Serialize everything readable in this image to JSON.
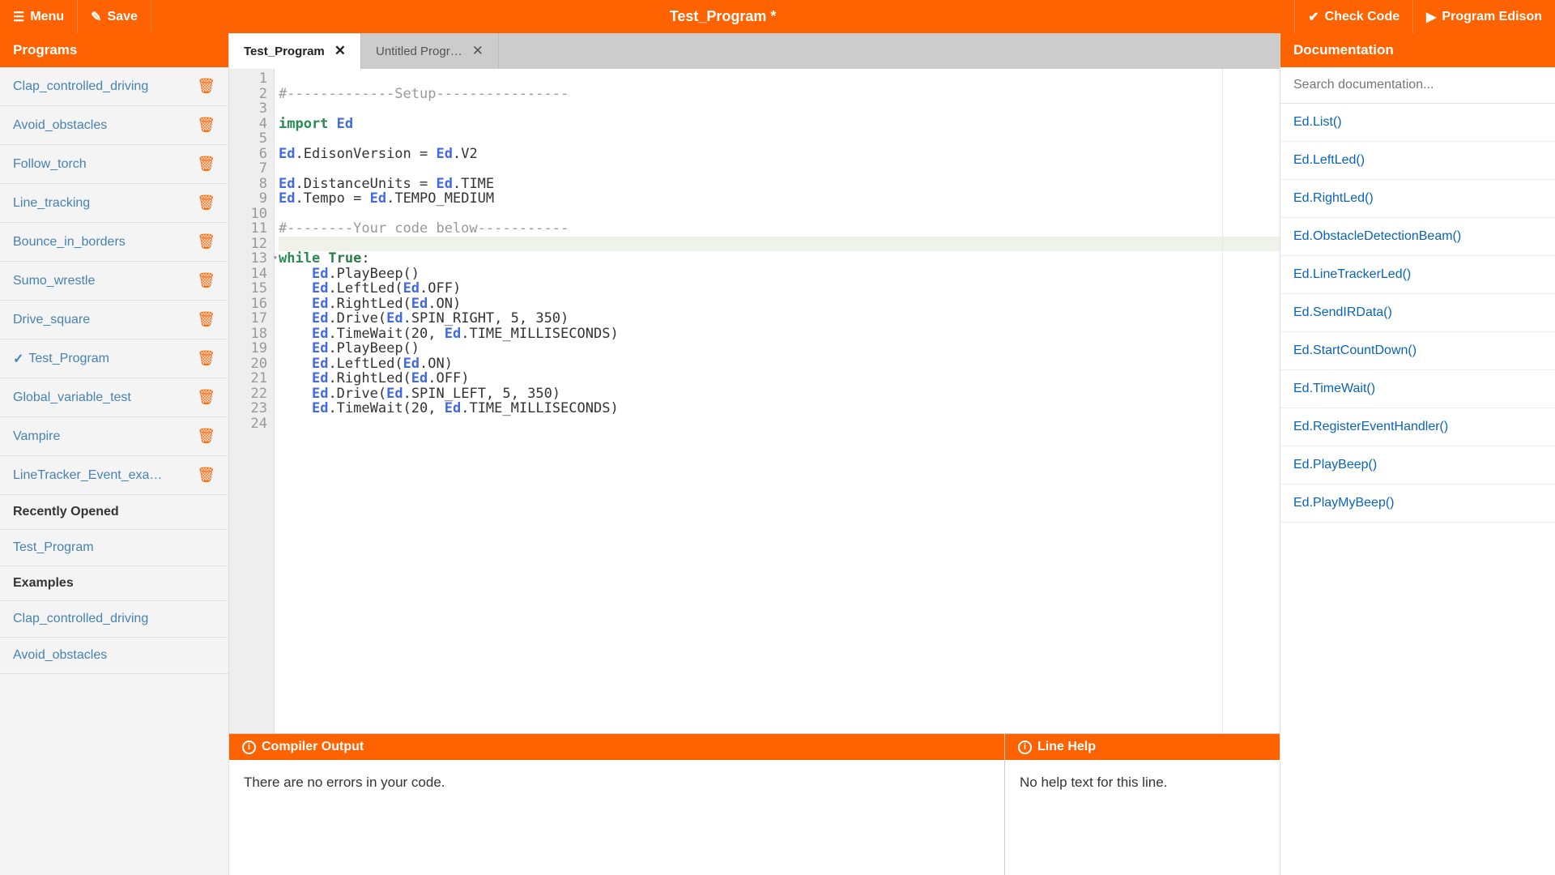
{
  "header": {
    "menu": "Menu",
    "save": "Save",
    "title": "Test_Program *",
    "check": "Check Code",
    "program": "Program Edison"
  },
  "sidebar": {
    "programs_header": "Programs",
    "recent_header": "Recently Opened",
    "examples_header": "Examples",
    "programs": [
      {
        "name": "Clap_controlled_driving",
        "selected": false
      },
      {
        "name": "Avoid_obstacles",
        "selected": false
      },
      {
        "name": "Follow_torch",
        "selected": false
      },
      {
        "name": "Line_tracking",
        "selected": false
      },
      {
        "name": "Bounce_in_borders",
        "selected": false
      },
      {
        "name": "Sumo_wrestle",
        "selected": false
      },
      {
        "name": "Drive_square",
        "selected": false
      },
      {
        "name": "Test_Program",
        "selected": true
      },
      {
        "name": "Global_variable_test",
        "selected": false
      },
      {
        "name": "Vampire",
        "selected": false
      },
      {
        "name": "LineTracker_Event_exa…",
        "selected": false
      }
    ],
    "recent": [
      {
        "name": "Test_Program"
      }
    ],
    "examples": [
      {
        "name": "Clap_controlled_driving"
      },
      {
        "name": "Avoid_obstacles"
      }
    ]
  },
  "tabs": [
    {
      "label": "Test_Program",
      "active": true
    },
    {
      "label": "Untitled Progr…",
      "active": false
    }
  ],
  "code": {
    "active_line": 12,
    "fold_lines": [
      13
    ],
    "lines": [
      {
        "n": 1,
        "t": [
          [
            "",
            ""
          ]
        ]
      },
      {
        "n": 2,
        "t": [
          [
            "cm",
            "#-------------Setup----------------"
          ]
        ]
      },
      {
        "n": 3,
        "t": [
          [
            "",
            ""
          ]
        ]
      },
      {
        "n": 4,
        "t": [
          [
            "kw",
            "import "
          ],
          [
            "mod",
            "Ed"
          ]
        ]
      },
      {
        "n": 5,
        "t": [
          [
            "",
            ""
          ]
        ]
      },
      {
        "n": 6,
        "t": [
          [
            "mod",
            "Ed"
          ],
          [
            "",
            ".EdisonVersion = "
          ],
          [
            "mod",
            "Ed"
          ],
          [
            "",
            ".V2"
          ]
        ]
      },
      {
        "n": 7,
        "t": [
          [
            "",
            ""
          ]
        ]
      },
      {
        "n": 8,
        "t": [
          [
            "mod",
            "Ed"
          ],
          [
            "",
            ".DistanceUnits = "
          ],
          [
            "mod",
            "Ed"
          ],
          [
            "",
            ".TIME"
          ]
        ]
      },
      {
        "n": 9,
        "t": [
          [
            "mod",
            "Ed"
          ],
          [
            "",
            ".Tempo = "
          ],
          [
            "mod",
            "Ed"
          ],
          [
            "",
            ".TEMPO_MEDIUM"
          ]
        ]
      },
      {
        "n": 10,
        "t": [
          [
            "",
            ""
          ]
        ]
      },
      {
        "n": 11,
        "t": [
          [
            "cm",
            "#--------Your code below-----------"
          ]
        ]
      },
      {
        "n": 12,
        "t": [
          [
            "",
            ""
          ]
        ]
      },
      {
        "n": 13,
        "t": [
          [
            "kw",
            "while "
          ],
          [
            "bool",
            "True"
          ],
          [
            "",
            ":"
          ]
        ]
      },
      {
        "n": 14,
        "t": [
          [
            "",
            "    "
          ],
          [
            "mod",
            "Ed"
          ],
          [
            "",
            ".PlayBeep()"
          ]
        ]
      },
      {
        "n": 15,
        "t": [
          [
            "",
            "    "
          ],
          [
            "mod",
            "Ed"
          ],
          [
            "",
            ".LeftLed("
          ],
          [
            "mod",
            "Ed"
          ],
          [
            "",
            ".OFF)"
          ]
        ]
      },
      {
        "n": 16,
        "t": [
          [
            "",
            "    "
          ],
          [
            "mod",
            "Ed"
          ],
          [
            "",
            ".RightLed("
          ],
          [
            "mod",
            "Ed"
          ],
          [
            "",
            ".ON)"
          ]
        ]
      },
      {
        "n": 17,
        "t": [
          [
            "",
            "    "
          ],
          [
            "mod",
            "Ed"
          ],
          [
            "",
            ".Drive("
          ],
          [
            "mod",
            "Ed"
          ],
          [
            "",
            ".SPIN_RIGHT, 5, 350)"
          ]
        ]
      },
      {
        "n": 18,
        "t": [
          [
            "",
            "    "
          ],
          [
            "mod",
            "Ed"
          ],
          [
            "",
            ".TimeWait(20, "
          ],
          [
            "mod",
            "Ed"
          ],
          [
            "",
            ".TIME_MILLISECONDS)"
          ]
        ]
      },
      {
        "n": 19,
        "t": [
          [
            "",
            "    "
          ],
          [
            "mod",
            "Ed"
          ],
          [
            "",
            ".PlayBeep()"
          ]
        ]
      },
      {
        "n": 20,
        "t": [
          [
            "",
            "    "
          ],
          [
            "mod",
            "Ed"
          ],
          [
            "",
            ".LeftLed("
          ],
          [
            "mod",
            "Ed"
          ],
          [
            "",
            ".ON)"
          ]
        ]
      },
      {
        "n": 21,
        "t": [
          [
            "",
            "    "
          ],
          [
            "mod",
            "Ed"
          ],
          [
            "",
            ".RightLed("
          ],
          [
            "mod",
            "Ed"
          ],
          [
            "",
            ".OFF)"
          ]
        ]
      },
      {
        "n": 22,
        "t": [
          [
            "",
            "    "
          ],
          [
            "mod",
            "Ed"
          ],
          [
            "",
            ".Drive("
          ],
          [
            "mod",
            "Ed"
          ],
          [
            "",
            ".SPIN_LEFT, 5, 350)"
          ]
        ]
      },
      {
        "n": 23,
        "t": [
          [
            "",
            "    "
          ],
          [
            "mod",
            "Ed"
          ],
          [
            "",
            ".TimeWait(20, "
          ],
          [
            "mod",
            "Ed"
          ],
          [
            "",
            ".TIME_MILLISECONDS)"
          ]
        ]
      },
      {
        "n": 24,
        "t": [
          [
            "",
            ""
          ]
        ]
      }
    ]
  },
  "docs": {
    "header": "Documentation",
    "search_placeholder": "Search documentation...",
    "items": [
      "Ed.List()",
      "Ed.LeftLed()",
      "Ed.RightLed()",
      "Ed.ObstacleDetectionBeam()",
      "Ed.LineTrackerLed()",
      "Ed.SendIRData()",
      "Ed.StartCountDown()",
      "Ed.TimeWait()",
      "Ed.RegisterEventHandler()",
      "Ed.PlayBeep()",
      "Ed.PlayMyBeep()"
    ]
  },
  "compiler": {
    "header": "Compiler Output",
    "body": "There are no errors in your code."
  },
  "linehelp": {
    "header": "Line Help",
    "body": "No help text for this line."
  }
}
